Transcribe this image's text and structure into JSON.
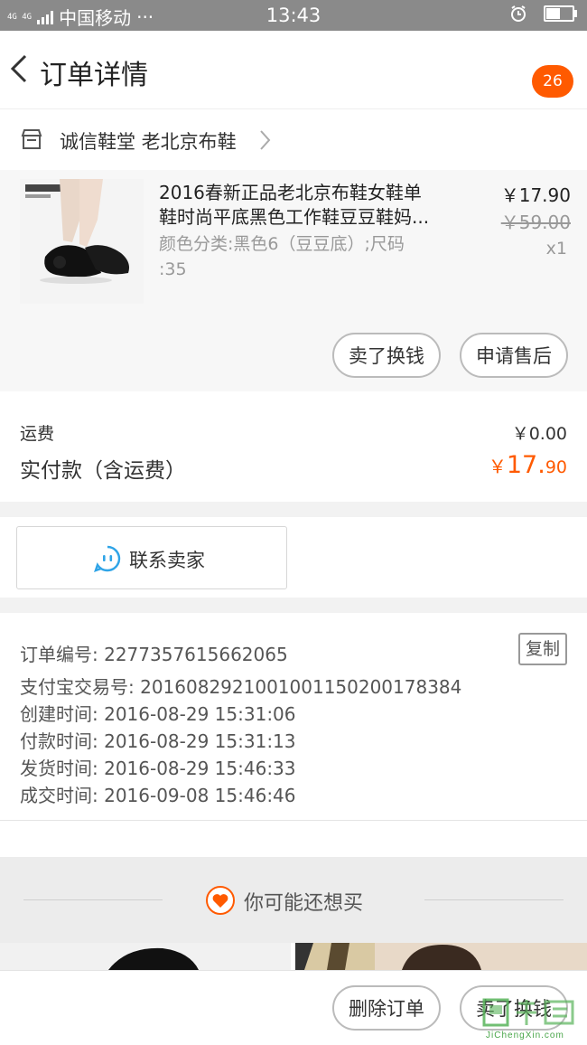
{
  "status_bar": {
    "network": "4G 4G",
    "carrier": "中国移动",
    "dots": "···",
    "time": "13:43",
    "battery_level": 0.55
  },
  "header": {
    "title": "订单详情",
    "badge_count": "26"
  },
  "shop": {
    "name": "诚信鞋堂 老北京布鞋"
  },
  "item": {
    "title_line1": "2016春新正品老北京布鞋女鞋单",
    "title_line2": "鞋时尚平底黑色工作鞋豆豆鞋妈...",
    "spec_line1": "颜色分类:黑色6（豆豆底）;尺码",
    "spec_line2": ":35",
    "price": "￥17.90",
    "original_price": "￥59.00",
    "quantity": "x1",
    "actions": {
      "resell": "卖了换钱",
      "after_sale": "申请售后"
    }
  },
  "payment": {
    "shipping_label": "运费",
    "shipping_value": "￥0.00",
    "total_label": "实付款（含运费）",
    "total_symbol": "￥",
    "total_int": "17.",
    "total_dec": "90"
  },
  "contact": {
    "label": "联系卖家"
  },
  "order_info": {
    "copy_label": "复制",
    "rows": [
      "订单编号: 2277357615662065",
      "支付宝交易号: 2016082921001001150200178384",
      "创建时间: 2016-08-29 15:31:06",
      "付款时间: 2016-08-29 15:31:13",
      "发货时间: 2016-08-29 15:46:33",
      "成交时间: 2016-09-08 15:46:46"
    ]
  },
  "recommend": {
    "label": "你可能还想买"
  },
  "bottom_bar": {
    "delete_order": "删除订单",
    "resell": "卖了换钱"
  },
  "watermark": {
    "text": "JiChengXin.com"
  },
  "colors": {
    "accent": "#ff5a00",
    "contact_icon": "#2fa4e7",
    "status_bar": "#8a8a8a"
  }
}
